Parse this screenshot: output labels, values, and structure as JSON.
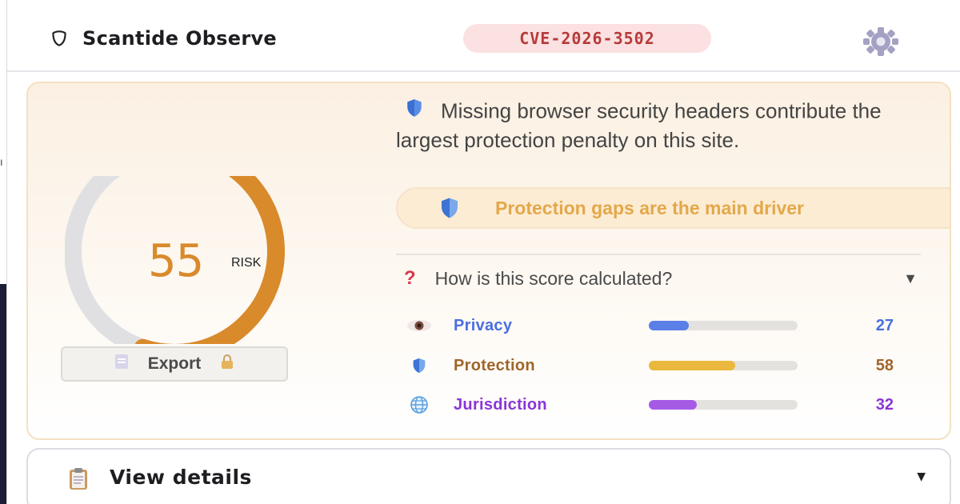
{
  "app": {
    "name": "Scantide Observe",
    "cve_badge": "CVE-2026-3502"
  },
  "score": {
    "value": "55",
    "unit": "RISK",
    "fraction": 0.55,
    "ring_color": "#d98a2b",
    "track_color": "#e0e0e3"
  },
  "export": {
    "label": "Export",
    "locked": true
  },
  "headline": "Missing browser security headers contribute the largest protection penalty on this site.",
  "driver": "Protection gaps are the main driver",
  "faq": {
    "question": "How is this score calculated?"
  },
  "metrics": [
    {
      "label": "Privacy",
      "value": "27",
      "fraction": 0.27,
      "color": "#4a6fe0",
      "bar_color": "#5a7fe6",
      "icon": "eye-icon"
    },
    {
      "label": "Protection",
      "value": "58",
      "fraction": 0.58,
      "color": "#a0652a",
      "bar_color": "#eab83c",
      "icon": "shield-icon"
    },
    {
      "label": "Jurisdiction",
      "value": "32",
      "fraction": 0.32,
      "color": "#8a35d6",
      "bar_color": "#a55be6",
      "icon": "globe-icon"
    }
  ],
  "details": {
    "label": "View details"
  }
}
